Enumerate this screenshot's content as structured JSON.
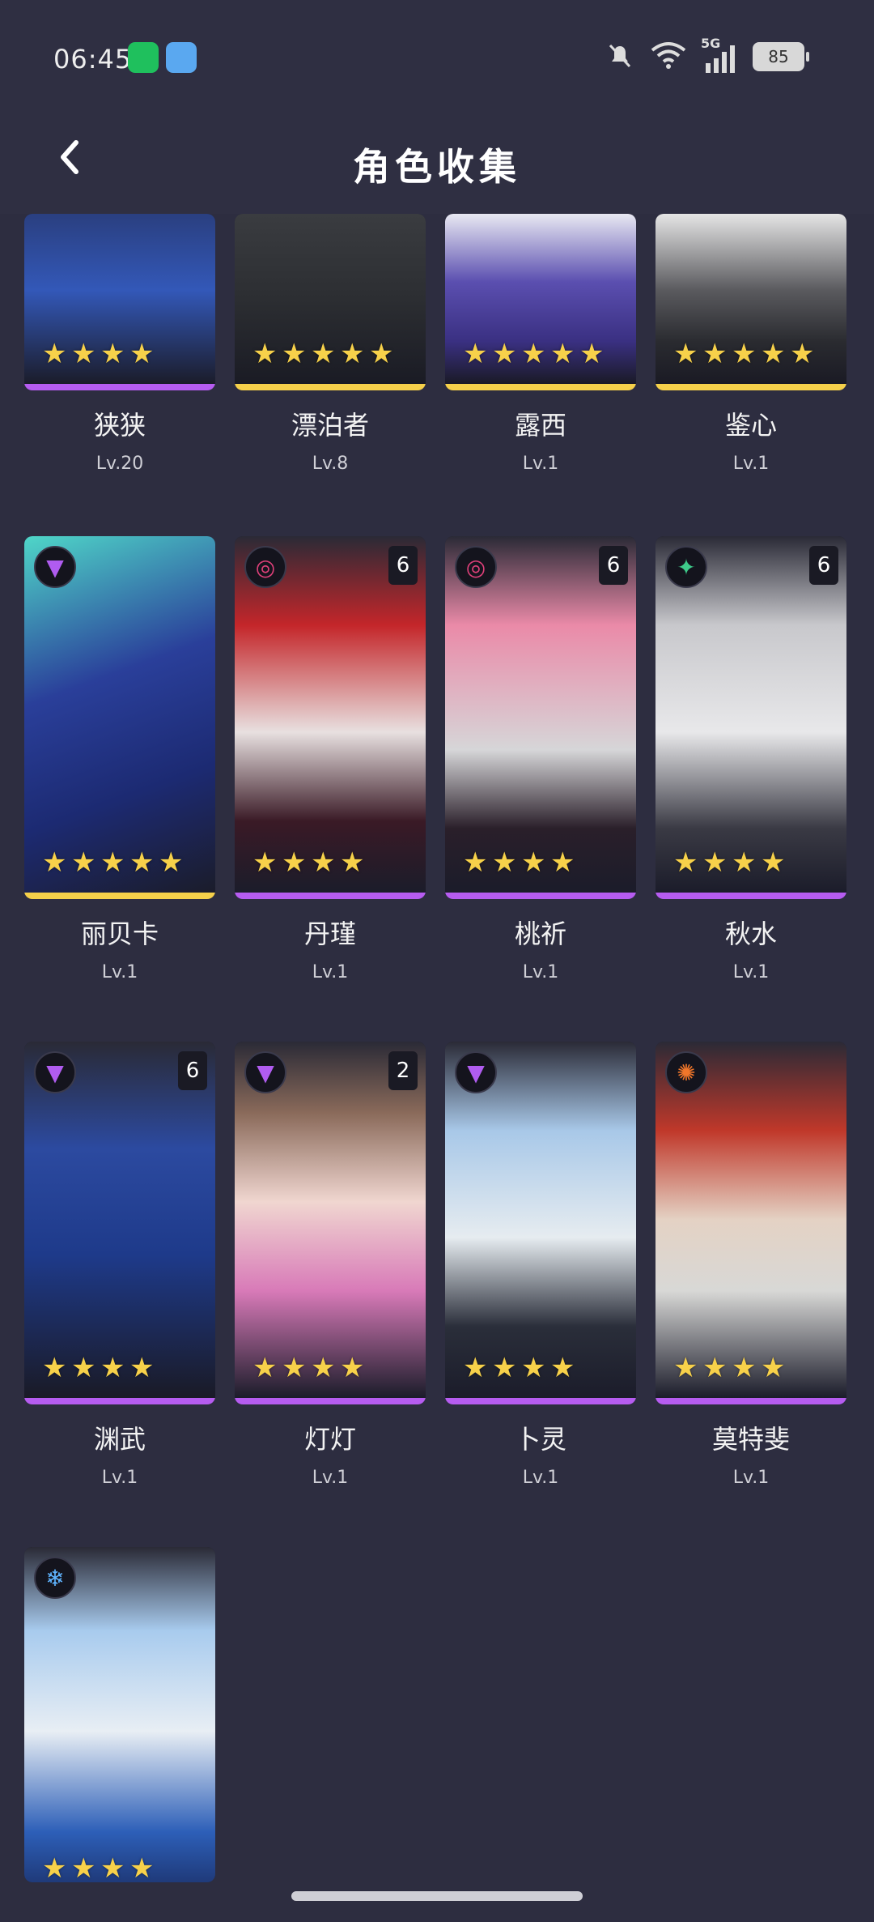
{
  "status_bar": {
    "time": "06:45",
    "icons": [
      "wechat-icon",
      "weather-icon"
    ],
    "right_icons": [
      "mute-icon",
      "wifi-icon",
      "signal-5g-icon"
    ],
    "network_label": "5G",
    "battery": "85"
  },
  "header": {
    "title": "角色收集",
    "back_icon": "chevron-left-icon"
  },
  "colors": {
    "background": "#2d2d40",
    "purple_rarity": "#b65cf0",
    "gold_rarity": "#f5d04a",
    "star": "#f7d14a"
  },
  "characters": [
    {
      "name": "狭狭",
      "level": "Lv.20",
      "stars": 4,
      "rarity": "purple"
    },
    {
      "name": "漂泊者",
      "level": "Lv.8",
      "stars": 5,
      "rarity": "gold"
    },
    {
      "name": "露西",
      "level": "Lv.1",
      "stars": 5,
      "rarity": "gold"
    },
    {
      "name": "鉴心",
      "level": "Lv.1",
      "stars": 5,
      "rarity": "gold"
    },
    {
      "name": "丽贝卡",
      "level": "Lv.1",
      "stars": 5,
      "rarity": "gold",
      "element": "void-icon"
    },
    {
      "name": "丹瑾",
      "level": "Lv.1",
      "stars": 4,
      "rarity": "purple",
      "element": "havoc-icon",
      "rank": "6"
    },
    {
      "name": "桃祈",
      "level": "Lv.1",
      "stars": 4,
      "rarity": "purple",
      "element": "havoc-icon",
      "rank": "6"
    },
    {
      "name": "秋水",
      "level": "Lv.1",
      "stars": 4,
      "rarity": "purple",
      "element": "aero-icon",
      "rank": "6"
    },
    {
      "name": "渊武",
      "level": "Lv.1",
      "stars": 4,
      "rarity": "purple",
      "element": "void-icon",
      "rank": "6"
    },
    {
      "name": "灯灯",
      "level": "Lv.1",
      "stars": 4,
      "rarity": "purple",
      "element": "void-icon",
      "rank": "2"
    },
    {
      "name": "卜灵",
      "level": "Lv.1",
      "stars": 4,
      "rarity": "purple",
      "element": "void-icon"
    },
    {
      "name": "莫特斐",
      "level": "Lv.1",
      "stars": 4,
      "rarity": "purple",
      "element": "fusion-icon"
    },
    {
      "element": "glacio-icon",
      "stars": 4
    }
  ]
}
